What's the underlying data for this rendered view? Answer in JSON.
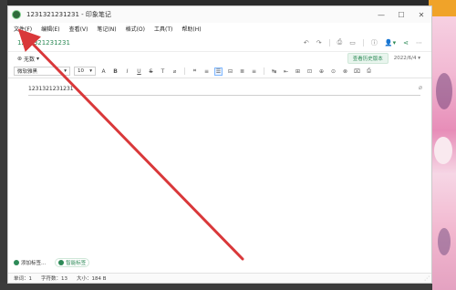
{
  "window": {
    "title": "1231321231231 - 印象笔记",
    "controls": {
      "minimize": "—",
      "maximize": "☐",
      "close": "✕"
    }
  },
  "menu": [
    "文件(F)",
    "编辑(E)",
    "查看(V)",
    "笔记(N)",
    "格式(O)",
    "工具(T)",
    "帮助(H)"
  ],
  "note": {
    "title": "1231321231231",
    "tag_label": "无数",
    "body_text": "1231321231231"
  },
  "history": {
    "button": "查看历史版本",
    "date": "2022/6/4"
  },
  "toolbar": {
    "font_family": "微软雅黑",
    "font_size": "10",
    "buttons": [
      "A",
      "B",
      "I",
      "U",
      "S",
      "T",
      "⌀",
      "⌗",
      "≡",
      "☰",
      "⊟",
      "≣",
      "≡",
      "↹",
      "⇤",
      "⊞",
      "⊡",
      "⊕",
      "⊙",
      "⊗",
      "⌧",
      "⎙"
    ]
  },
  "bottom": {
    "add_tag": "添加标签...",
    "smart_tag": "智能标签"
  },
  "status": {
    "words": "单词：1",
    "chars": "字符数：13",
    "size": "大小：184 B"
  },
  "colors": {
    "accent": "#2d8a57",
    "arrow": "#d9383a"
  }
}
